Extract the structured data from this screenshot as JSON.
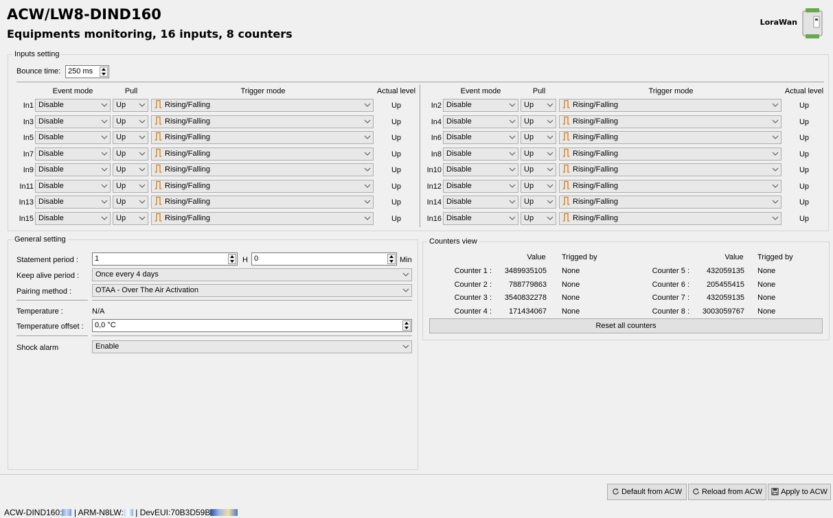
{
  "header": {
    "title": "ACW/LW8-DIND160",
    "subtitle": "Equipments monitoring, 16 inputs, 8 counters",
    "network": "LoraWan"
  },
  "inputs": {
    "legend": "Inputs setting",
    "bounce_label": "Bounce time:",
    "bounce_value": "250 ms",
    "headers": {
      "event": "Event mode",
      "pull": "Pull",
      "trigger": "Trigger mode",
      "level": "Actual level"
    },
    "left": [
      {
        "label": "In1",
        "event": "Disable",
        "pull": "Up",
        "trigger": "Rising/Falling",
        "level": "Up"
      },
      {
        "label": "In3",
        "event": "Disable",
        "pull": "Up",
        "trigger": "Rising/Falling",
        "level": "Up"
      },
      {
        "label": "In5",
        "event": "Disable",
        "pull": "Up",
        "trigger": "Rising/Falling",
        "level": "Up"
      },
      {
        "label": "In7",
        "event": "Disable",
        "pull": "Up",
        "trigger": "Rising/Falling",
        "level": "Up"
      },
      {
        "label": "In9",
        "event": "Disable",
        "pull": "Up",
        "trigger": "Rising/Falling",
        "level": "Up"
      },
      {
        "label": "In11",
        "event": "Disable",
        "pull": "Up",
        "trigger": "Rising/Falling",
        "level": "Up"
      },
      {
        "label": "In13",
        "event": "Disable",
        "pull": "Up",
        "trigger": "Rising/Falling",
        "level": "Up"
      },
      {
        "label": "In15",
        "event": "Disable",
        "pull": "Up",
        "trigger": "Rising/Falling",
        "level": "Up"
      }
    ],
    "right": [
      {
        "label": "In2",
        "event": "Disable",
        "pull": "Up",
        "trigger": "Rising/Falling",
        "level": "Up"
      },
      {
        "label": "In4",
        "event": "Disable",
        "pull": "Up",
        "trigger": "Rising/Falling",
        "level": "Up"
      },
      {
        "label": "In6",
        "event": "Disable",
        "pull": "Up",
        "trigger": "Rising/Falling",
        "level": "Up"
      },
      {
        "label": "In8",
        "event": "Disable",
        "pull": "Up",
        "trigger": "Rising/Falling",
        "level": "Up"
      },
      {
        "label": "In10",
        "event": "Disable",
        "pull": "Up",
        "trigger": "Rising/Falling",
        "level": "Up"
      },
      {
        "label": "In12",
        "event": "Disable",
        "pull": "Up",
        "trigger": "Rising/Falling",
        "level": "Up"
      },
      {
        "label": "In14",
        "event": "Disable",
        "pull": "Up",
        "trigger": "Rising/Falling",
        "level": "Up"
      },
      {
        "label": "In16",
        "event": "Disable",
        "pull": "Up",
        "trigger": "Rising/Falling",
        "level": "Up"
      }
    ]
  },
  "general": {
    "legend": "General setting",
    "statement_label": "Statement period :",
    "statement_hours": "1",
    "hours_unit": "H",
    "statement_minutes": "0",
    "minutes_unit": "Min",
    "keepalive_label": "Keep alive period :",
    "keepalive_value": "Once every 4 days",
    "pairing_label": "Pairing method :",
    "pairing_value": "OTAA - Over The Air Activation",
    "temperature_label": "Temperature :",
    "temperature_value": "N/A",
    "offset_label": "Temperature offset :",
    "offset_value": "0,0 °C",
    "shock_label": "Shock alarm",
    "shock_value": "Enable"
  },
  "counters": {
    "legend": "Counters view",
    "value_header": "Value",
    "trigger_header": "Trigged by",
    "left": [
      {
        "name": "Counter 1 :",
        "value": "3489935105",
        "trig": "None"
      },
      {
        "name": "Counter 2 :",
        "value": "788779863",
        "trig": "None"
      },
      {
        "name": "Counter 3 :",
        "value": "3540832278",
        "trig": "None"
      },
      {
        "name": "Counter 4 :",
        "value": "171434067",
        "trig": "None"
      }
    ],
    "right": [
      {
        "name": "Counter 5 :",
        "value": "432059135",
        "trig": "None"
      },
      {
        "name": "Counter 6 :",
        "value": "205455415",
        "trig": "None"
      },
      {
        "name": "Counter 7 :",
        "value": "432059135",
        "trig": "None"
      },
      {
        "name": "Counter 8 :",
        "value": "3003059767",
        "trig": "None"
      }
    ],
    "reset_label": "Reset all counters"
  },
  "actions": {
    "default_label": "Default from ACW",
    "reload_label": "Reload from ACW",
    "apply_label": "Apply to ACW"
  },
  "status": {
    "fw_label": "ACW-DIND160:",
    "arm_label": "| ARM-N8LW:",
    "deveui_label": "| DevEUI:70B3D59B"
  }
}
